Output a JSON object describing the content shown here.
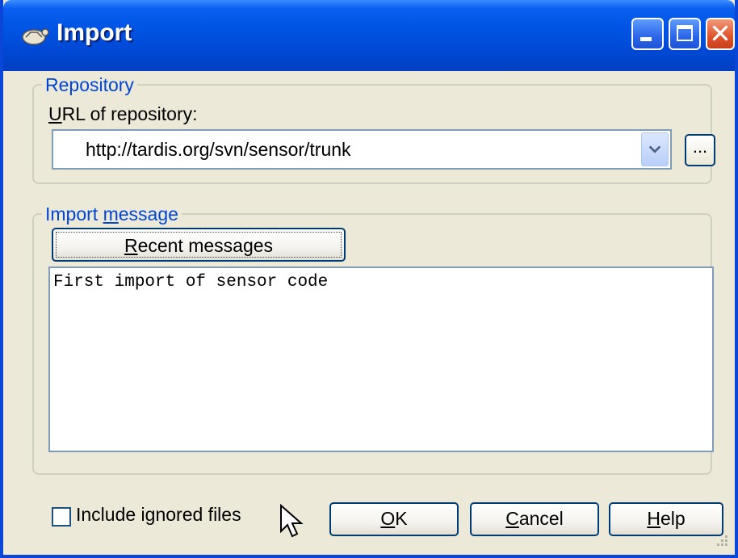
{
  "window": {
    "title": "Import",
    "app_icon": "turtle-icon"
  },
  "titlebar_buttons": {
    "minimize_icon": "minimize-icon",
    "maximize_icon": "maximize-icon",
    "close_icon": "close-icon"
  },
  "repository": {
    "legend": "Repository",
    "url_label_first": "U",
    "url_label_rest": "RL of repository:",
    "url_value": "http://tardis.org/svn/sensor/trunk",
    "browse_label": "..."
  },
  "import_message": {
    "legend_pre": "Import ",
    "legend_ul": "m",
    "legend_post": "essage",
    "recent_ul": "R",
    "recent_rest": "ecent messages",
    "message": "First import of sensor code"
  },
  "footer": {
    "include_ignored_label": "Include ignored files",
    "include_ignored_checked": false,
    "ok_ul": "O",
    "ok_rest": "K",
    "cancel_ul": "C",
    "cancel_rest": "ancel",
    "help_ul": "H",
    "help_rest": "elp"
  },
  "colors": {
    "titlebar": "#0054e3",
    "dialog_bg": "#ece9d8",
    "group_legend": "#0046d5"
  }
}
